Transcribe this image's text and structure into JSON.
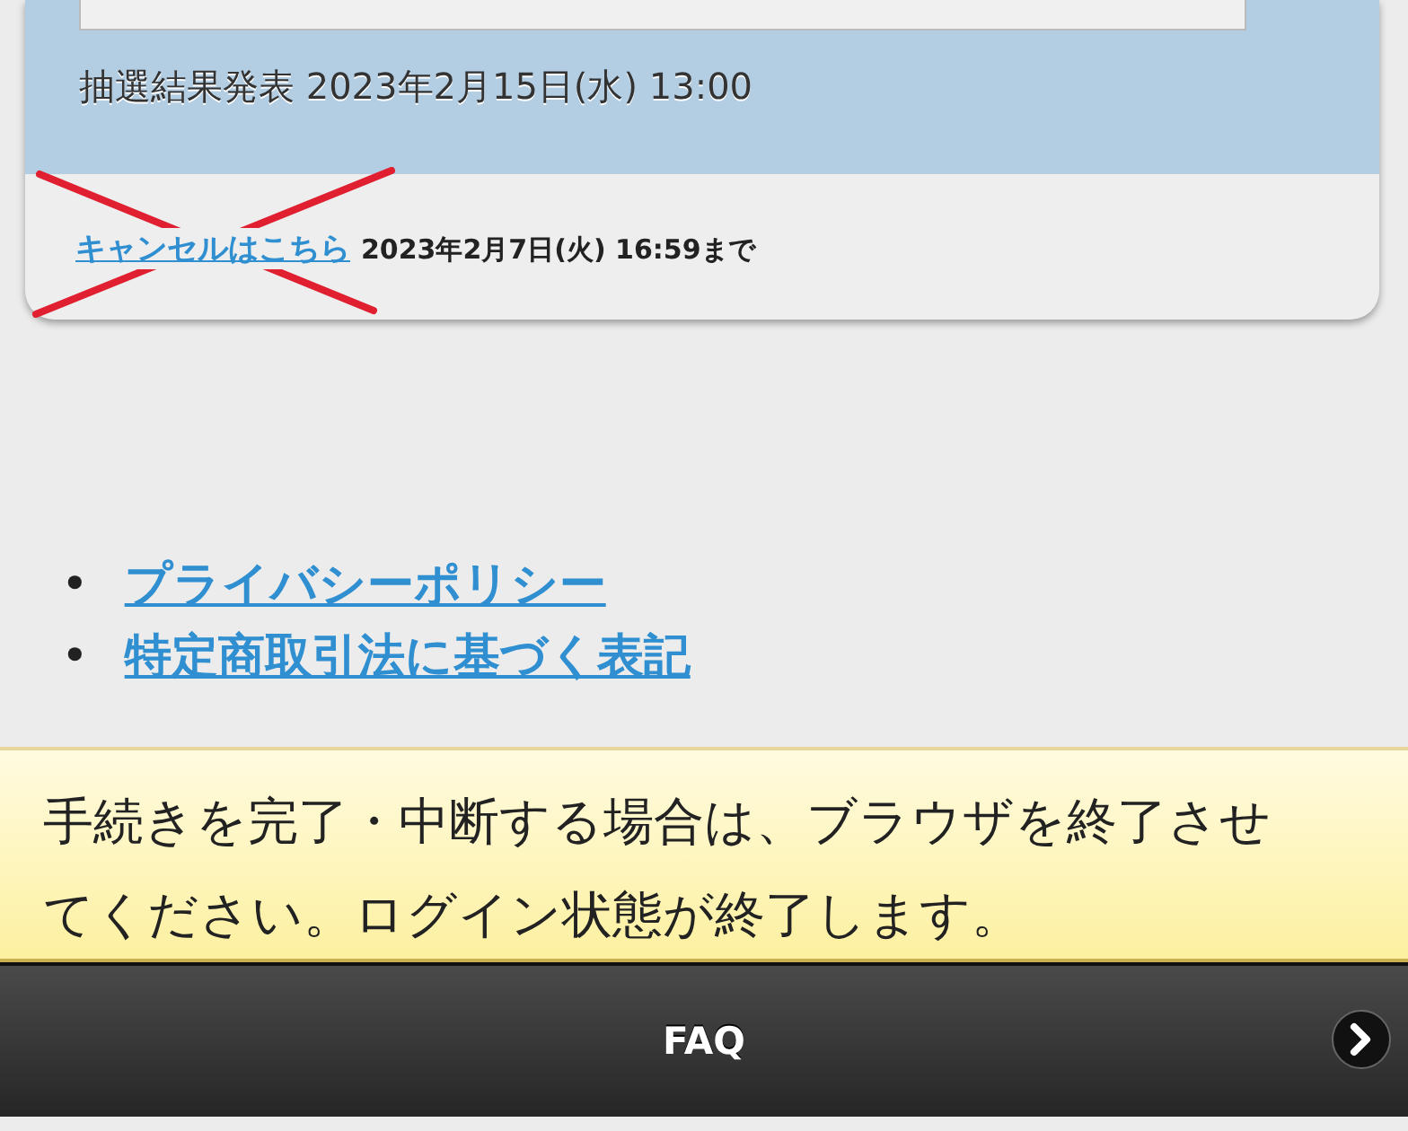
{
  "lottery": {
    "result_announcement": "抽選結果発表 2023年2月15日(水) 13:00"
  },
  "cancel": {
    "link": "キャンセルはこちら",
    "deadline": "2023年2月7日(火) 16:59まで",
    "crossed_out": true
  },
  "footer_links": [
    {
      "bullet": "•",
      "label": "プライバシーポリシー"
    },
    {
      "bullet": "•",
      "label": "特定商取引法に基づく表記"
    }
  ],
  "notice": "手続きを完了・中断する場合は、ブラウザを終了させてください。ログイン状態が終了します。",
  "bottom_bar": {
    "label": "FAQ"
  }
}
